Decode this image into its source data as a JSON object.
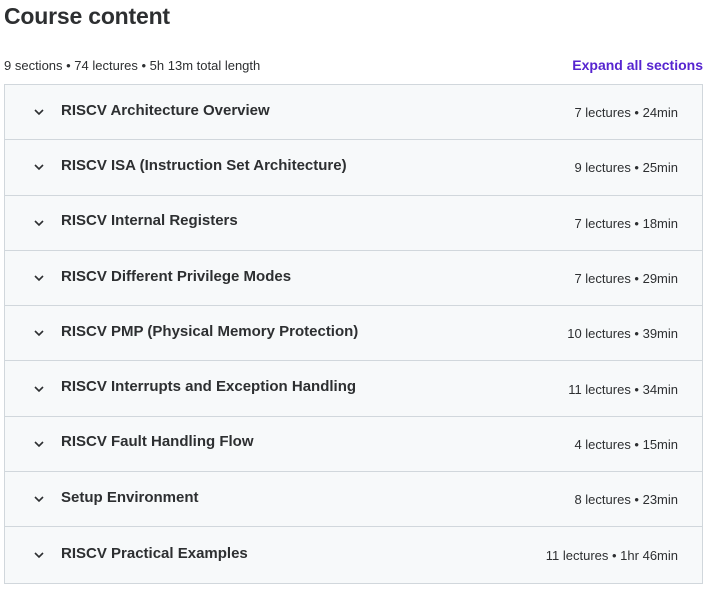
{
  "header": {
    "title": "Course content",
    "summary": "9 sections • 74 lectures • 5h 13m total length",
    "expand_label": "Expand all sections"
  },
  "colors": {
    "accent": "#5624d0",
    "text": "#2d2f31",
    "row_bg": "#f7f9fa",
    "border": "#d1d7dc"
  },
  "sections": [
    {
      "title": "RISCV Architecture Overview",
      "info": "7 lectures • 24min",
      "icon": "chevron-down-icon"
    },
    {
      "title": "RISCV ISA (Instruction Set Architecture)",
      "info": "9 lectures • 25min",
      "icon": "chevron-down-icon"
    },
    {
      "title": "RISCV Internal Registers",
      "info": "7 lectures • 18min",
      "icon": "chevron-down-icon"
    },
    {
      "title": "RISCV Different Privilege Modes",
      "info": "7 lectures • 29min",
      "icon": "chevron-down-icon"
    },
    {
      "title": "RISCV PMP (Physical Memory Protection)",
      "info": "10 lectures • 39min",
      "icon": "chevron-down-icon"
    },
    {
      "title": "RISCV Interrupts and Exception Handling",
      "info": "11 lectures • 34min",
      "icon": "chevron-down-icon"
    },
    {
      "title": "RISCV Fault Handling Flow",
      "info": "4 lectures • 15min",
      "icon": "chevron-down-icon"
    },
    {
      "title": "Setup Environment",
      "info": "8 lectures • 23min",
      "icon": "chevron-down-icon"
    },
    {
      "title": "RISCV Practical Examples",
      "info": "11 lectures • 1hr 46min",
      "icon": "chevron-down-icon"
    }
  ]
}
